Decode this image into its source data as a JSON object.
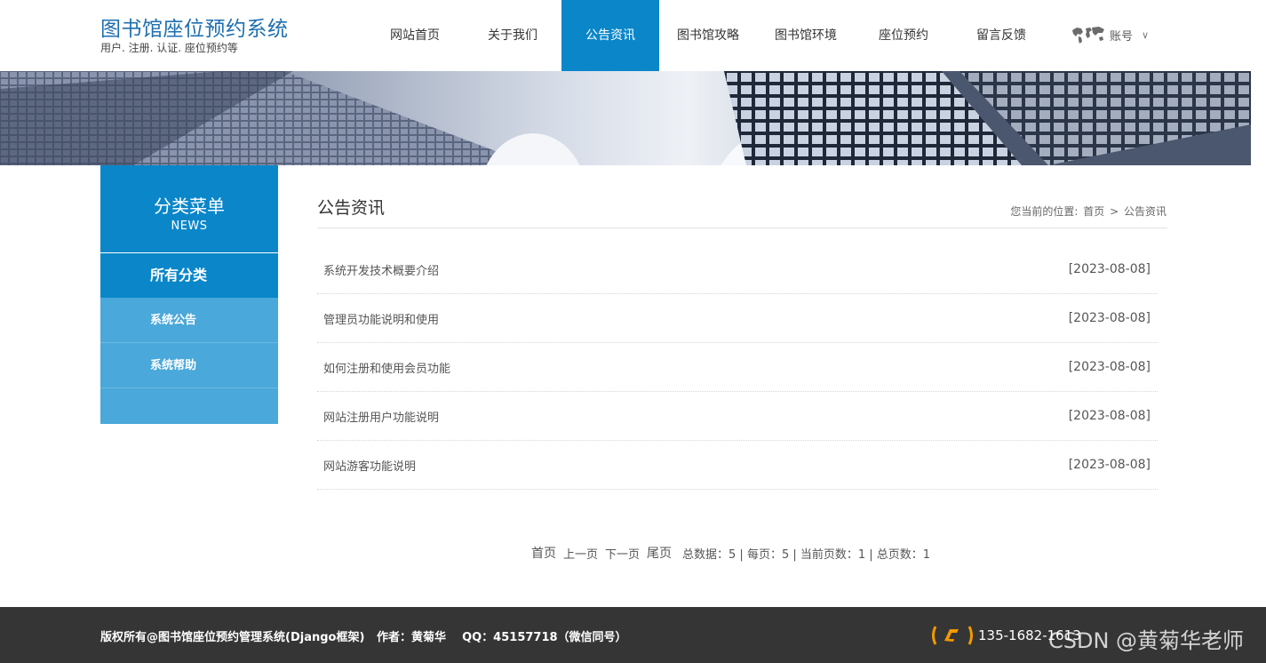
{
  "site": {
    "title": "图书馆座位预约系统",
    "subtitle": "用户. 注册. 认证. 座位预约等"
  },
  "nav": [
    {
      "label": "网站首页",
      "active": false
    },
    {
      "label": "关于我们",
      "active": false
    },
    {
      "label": "公告资讯",
      "active": true
    },
    {
      "label": "图书馆攻略",
      "active": false
    },
    {
      "label": "图书馆环境",
      "active": false
    },
    {
      "label": "座位预约",
      "active": false
    },
    {
      "label": "留言反馈",
      "active": false
    }
  ],
  "account": {
    "label": "账号",
    "icon": "world-map-icon"
  },
  "sidebar": {
    "heading": "分类菜单",
    "heading_en": "NEWS",
    "all_label": "所有分类",
    "items": [
      {
        "label": "系统公告"
      },
      {
        "label": "系统帮助"
      }
    ]
  },
  "main": {
    "title": "公告资讯",
    "breadcrumb_prefix": "您当前的位置:",
    "breadcrumb_home": "首页",
    "breadcrumb_sep": ">",
    "breadcrumb_current": "公告资讯"
  },
  "news": [
    {
      "title": "系统开发技术概要介绍",
      "date": "[2023-08-08]"
    },
    {
      "title": "管理员功能说明和使用",
      "date": "[2023-08-08]"
    },
    {
      "title": "如何注册和使用会员功能",
      "date": "[2023-08-08]"
    },
    {
      "title": "网站注册用户功能说明",
      "date": "[2023-08-08]"
    },
    {
      "title": "网站游客功能说明",
      "date": "[2023-08-08]"
    }
  ],
  "pager": {
    "first": "首页",
    "prev": "上一页",
    "next": "下一页",
    "last": "尾页",
    "info": "总数据：5 | 每页：5 | 当前页数：1 | 总页数：1"
  },
  "footer": {
    "copyright": "版权所有@图书馆座位预约管理系统(Django框架)   作者：黄菊华    QQ：45157718（微信同号）",
    "phone": "135-1682-1613",
    "watermark": "CSDN @黄菊华老师",
    "accent_color": "#f39800"
  },
  "colors": {
    "primary": "#0a86c9",
    "sidebar_light": "#4aa8da",
    "footer_bg": "#353535"
  }
}
